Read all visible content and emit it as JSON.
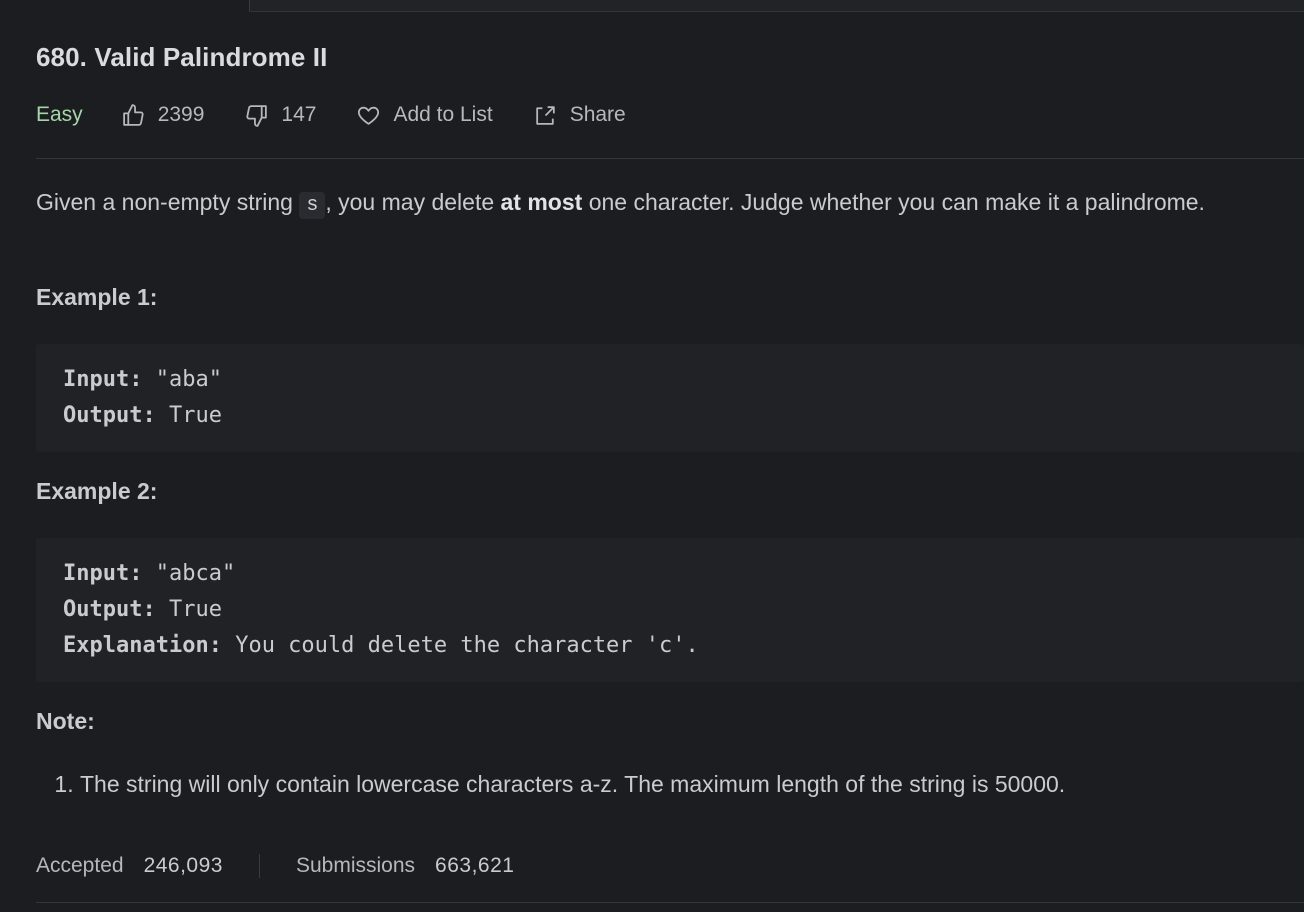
{
  "problem": {
    "title": "680. Valid Palindrome II",
    "difficulty": "Easy",
    "likes": "2399",
    "dislikes": "147",
    "add_to_list_label": "Add to List",
    "share_label": "Share"
  },
  "description": {
    "part1": "Given a non-empty string ",
    "code": "s",
    "part2": ", you may delete ",
    "bold": "at most",
    "part3": " one character. Judge whether you can make it a palindrome."
  },
  "examples": [
    {
      "heading": "Example 1:",
      "input_key": "Input:",
      "input_val": " \"aba\"",
      "output_key": "Output:",
      "output_val": " True"
    },
    {
      "heading": "Example 2:",
      "input_key": "Input:",
      "input_val": " \"abca\"",
      "output_key": "Output:",
      "output_val": " True",
      "explanation_key": "Explanation:",
      "explanation_val": " You could delete the character 'c'."
    }
  ],
  "note": {
    "heading": "Note:",
    "items": [
      "The string will only contain lowercase characters a-z. The maximum length of the string is 50000."
    ]
  },
  "stats": {
    "accepted_label": "Accepted",
    "accepted_value": "246,093",
    "submissions_label": "Submissions",
    "submissions_value": "663,621"
  },
  "icons": {
    "like": "thumbs-up-icon",
    "dislike": "thumbs-down-icon",
    "add_to_list": "heart-icon",
    "share": "share-icon"
  },
  "colors": {
    "background": "#1c1d21",
    "easy": "#a5d6a7",
    "code_block": "#212225"
  }
}
